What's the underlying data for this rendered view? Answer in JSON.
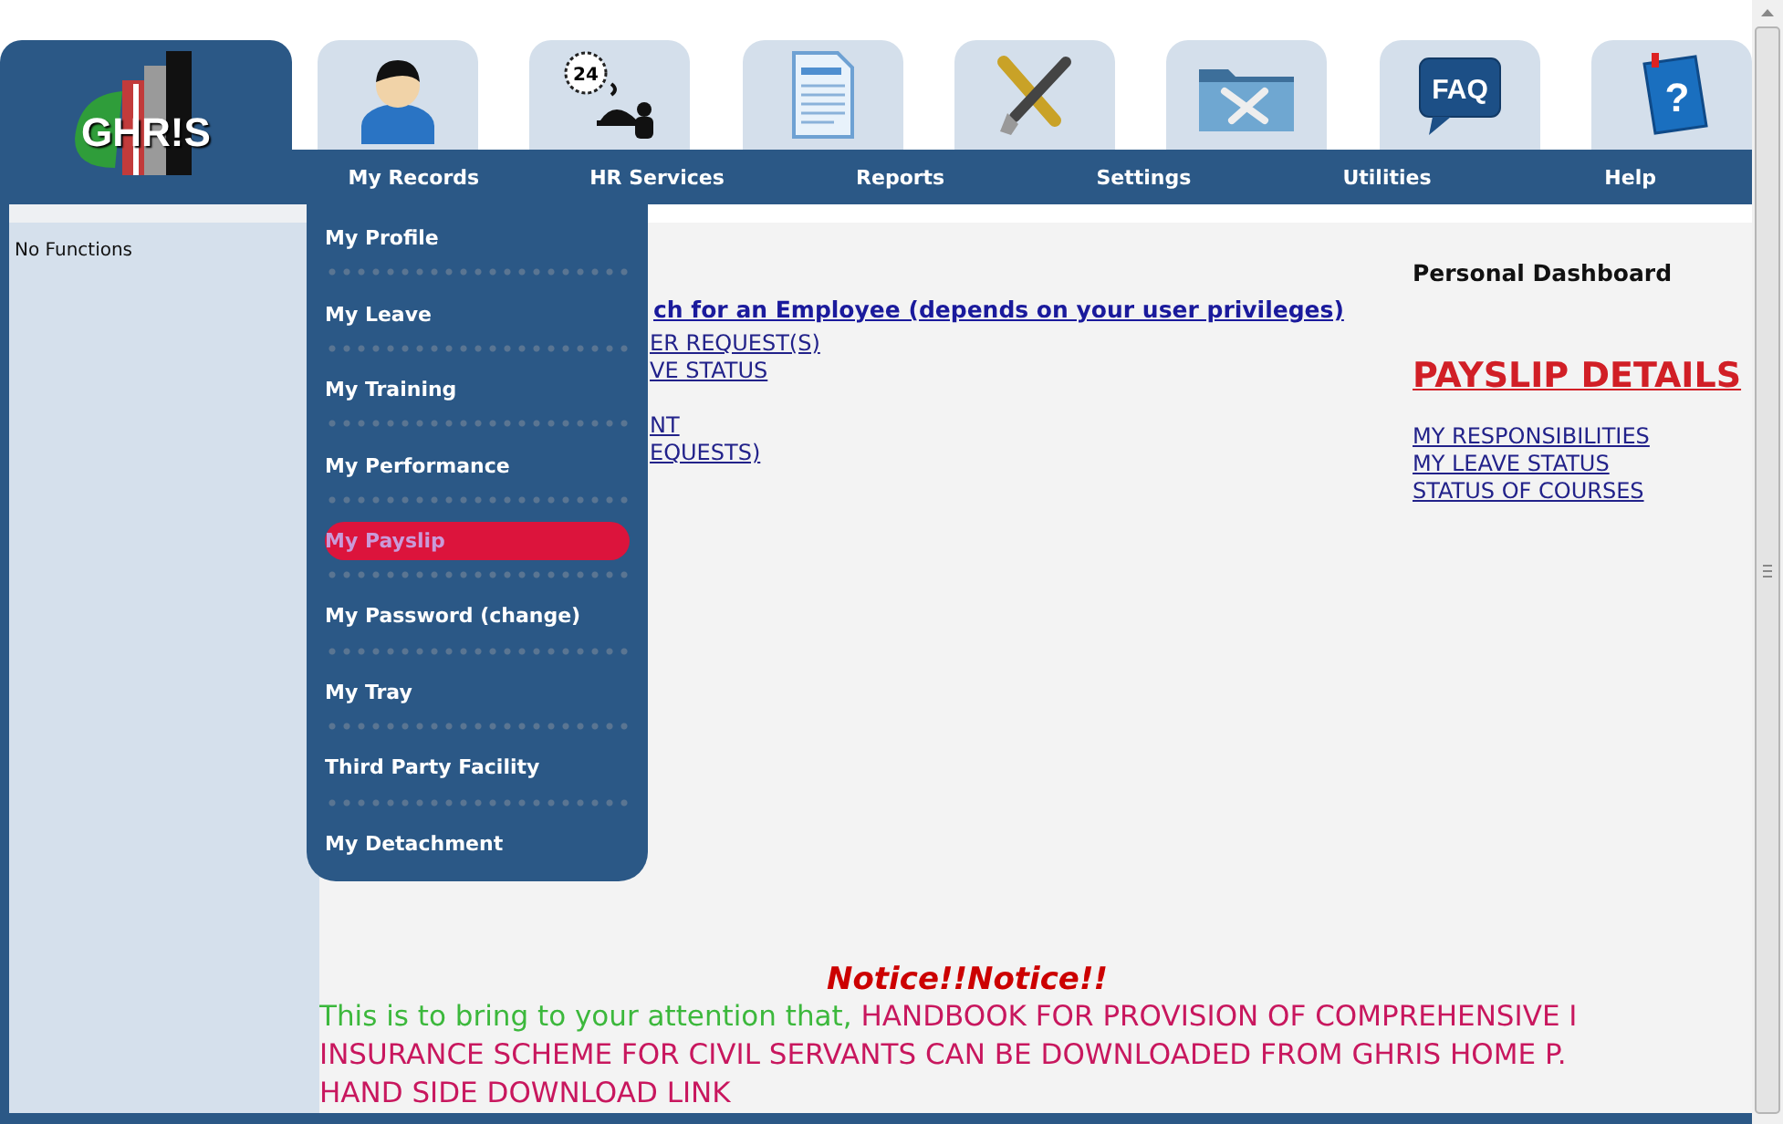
{
  "logo": {
    "text": "GHR!S"
  },
  "icon_tabs": [
    {
      "kind": "person"
    },
    {
      "kind": "service",
      "icon_text": "24"
    },
    {
      "kind": "document"
    },
    {
      "kind": "tools"
    },
    {
      "kind": "folder"
    },
    {
      "kind": "faq",
      "icon_text": "FAQ"
    },
    {
      "kind": "help",
      "icon_text": "?"
    }
  ],
  "nav": [
    {
      "label": "My Records",
      "menu": [
        {
          "label": "My Profile",
          "selected": false
        },
        {
          "label": "My Leave",
          "selected": false
        },
        {
          "label": "My Training",
          "selected": false
        },
        {
          "label": "My Performance",
          "selected": false
        },
        {
          "label": "My Payslip",
          "selected": true
        },
        {
          "label": "My Password (change)",
          "selected": false
        },
        {
          "label": "My Tray",
          "selected": false
        },
        {
          "label": "Third Party Facility",
          "selected": false
        },
        {
          "label": "My Detachment",
          "selected": false
        }
      ]
    },
    {
      "label": "HR Services"
    },
    {
      "label": "Reports"
    },
    {
      "label": "Settings"
    },
    {
      "label": "Utilities"
    },
    {
      "label": "Help"
    }
  ],
  "sidebar": {
    "text": "No Functions"
  },
  "main": {
    "search_link": "ch for an Employee (depends on your user privileges)",
    "link_groups": [
      [
        "ER REQUEST(S)",
        "VE STATUS"
      ],
      [
        "NT",
        "EQUESTS)"
      ]
    ],
    "dashboard": {
      "title": "Personal Dashboard",
      "heading": "PAYSLIP DETAILS",
      "links": [
        "MY RESPONSIBILITIES",
        "MY LEAVE STATUS",
        "STATUS OF COURSES"
      ]
    },
    "notice": {
      "title": "Notice!!Notice!!",
      "lead": "This is to bring to your attention that, ",
      "lines": [
        "HANDBOOK FOR PROVISION OF COMPREHENSIVE I",
        "INSURANCE SCHEME FOR CIVIL SERVANTS CAN BE DOWNLOADED FROM GHRIS HOME P.",
        "HAND SIDE DOWNLOAD LINK"
      ]
    }
  }
}
